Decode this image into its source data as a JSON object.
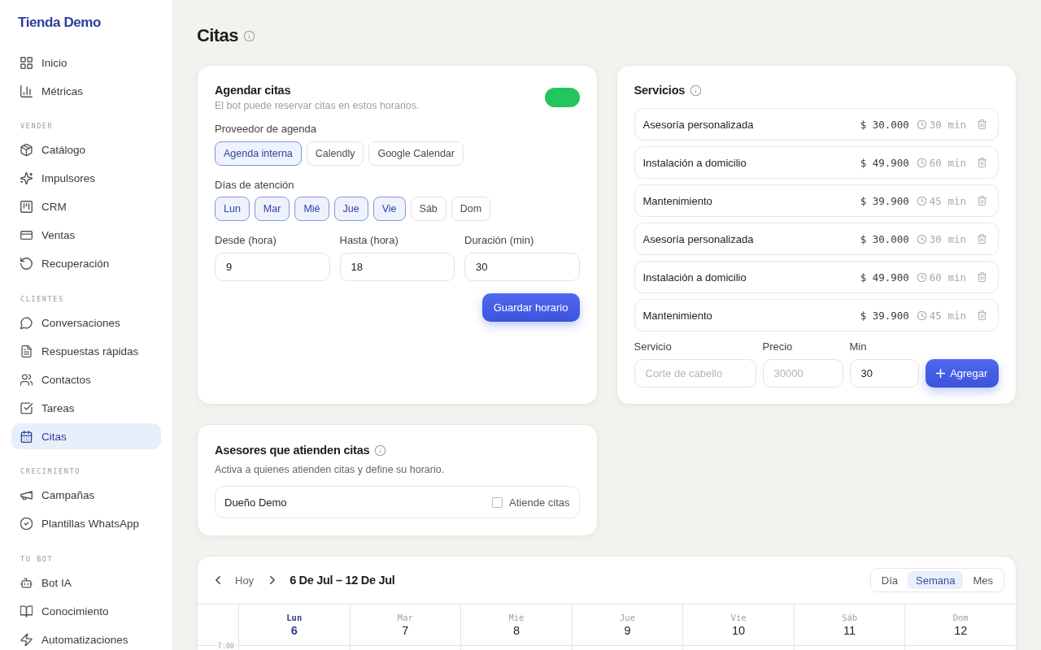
{
  "sidebar": {
    "brand": "Tienda Demo",
    "sections": [
      {
        "items": [
          {
            "label": "Inicio",
            "selected": false
          },
          {
            "label": "Métricas",
            "selected": false
          }
        ]
      },
      {
        "label": "VENDER",
        "items": [
          {
            "label": "Catálogo",
            "selected": false
          },
          {
            "label": "Impulsores",
            "selected": false
          },
          {
            "label": "CRM",
            "selected": false
          },
          {
            "label": "Ventas",
            "selected": false
          },
          {
            "label": "Recuperación",
            "selected": false
          }
        ]
      },
      {
        "label": "CLIENTES",
        "items": [
          {
            "label": "Conversaciones",
            "selected": false
          },
          {
            "label": "Respuestas rápidas",
            "selected": false
          },
          {
            "label": "Contactos",
            "selected": false
          },
          {
            "label": "Tareas",
            "selected": false
          },
          {
            "label": "Citas",
            "selected": true
          }
        ]
      },
      {
        "label": "CRECIMIENTO",
        "items": [
          {
            "label": "Campañas",
            "selected": false
          },
          {
            "label": "Plantillas WhatsApp",
            "selected": false
          }
        ]
      },
      {
        "label": "TU BOT",
        "items": [
          {
            "label": "Bot IA",
            "selected": false
          },
          {
            "label": "Conocimiento",
            "selected": false
          },
          {
            "label": "Automatizaciones",
            "selected": false
          }
        ]
      }
    ]
  },
  "page": {
    "title": "Citas"
  },
  "schedule": {
    "title": "Agendar citas",
    "subtitle": "El bot puede reservar citas en estos horarios.",
    "on": true,
    "provider_label": "Proveedor de agenda",
    "providers": [
      {
        "label": "Agenda interna",
        "selected": true
      },
      {
        "label": "Calendly",
        "selected": false
      },
      {
        "label": "Google Calendar",
        "selected": false
      }
    ],
    "days_label": "Días de atención",
    "days": [
      {
        "label": "Lun",
        "selected": true
      },
      {
        "label": "Mar",
        "selected": true
      },
      {
        "label": "Mié",
        "selected": true
      },
      {
        "label": "Jue",
        "selected": true
      },
      {
        "label": "Vie",
        "selected": true
      },
      {
        "label": "Sáb",
        "selected": false
      },
      {
        "label": "Dom",
        "selected": false
      }
    ],
    "fields": [
      {
        "label": "Desde (hora)",
        "value": "9"
      },
      {
        "label": "Hasta (hora)",
        "value": "18"
      },
      {
        "label": "Duración (min)",
        "value": "30"
      }
    ],
    "save_button": "Guardar horario"
  },
  "services": {
    "title": "Servicios",
    "items": [
      {
        "name": "Asesoría personalizada",
        "price": "$ 30.000",
        "duration": "30 min"
      },
      {
        "name": "Instalación a domicilio",
        "price": "$ 49.900",
        "duration": "60 min"
      },
      {
        "name": "Mantenimiento",
        "price": "$ 39.900",
        "duration": "45 min"
      },
      {
        "name": "Asesoría personalizada",
        "price": "$ 30.000",
        "duration": "30 min"
      },
      {
        "name": "Instalación a domicilio",
        "price": "$ 49.900",
        "duration": "60 min"
      },
      {
        "name": "Mantenimiento",
        "price": "$ 39.900",
        "duration": "45 min"
      }
    ],
    "form": {
      "fields": [
        {
          "label": "Servicio",
          "placeholder": "Corte de cabello"
        },
        {
          "label": "Precio",
          "placeholder": "30000"
        },
        {
          "label": "Min",
          "value": "30"
        }
      ],
      "add_button": "Agregar"
    }
  },
  "advisors": {
    "title": "Asesores que atienden citas",
    "subtitle": "Activa a quienes atienden citas y define su horario.",
    "items": [
      {
        "name": "Dueño Demo",
        "checkbox_label": "Atiende citas",
        "checked": false
      }
    ]
  },
  "calendar": {
    "today_button": "Hoy",
    "range": "6 De Jul – 12 De Jul",
    "views": [
      {
        "label": "Día",
        "selected": false
      },
      {
        "label": "Semana",
        "selected": true
      },
      {
        "label": "Mes",
        "selected": false
      }
    ],
    "days": [
      {
        "weekday": "Lun",
        "date": "6",
        "today": true
      },
      {
        "weekday": "Mar",
        "date": "7",
        "today": false
      },
      {
        "weekday": "Mié",
        "date": "8",
        "today": false
      },
      {
        "weekday": "Jue",
        "date": "9",
        "today": false
      },
      {
        "weekday": "Vie",
        "date": "10",
        "today": false
      },
      {
        "weekday": "Sáb",
        "date": "11",
        "today": false
      },
      {
        "weekday": "Dom",
        "date": "12",
        "today": false
      }
    ],
    "times": [
      "7:00"
    ]
  }
}
